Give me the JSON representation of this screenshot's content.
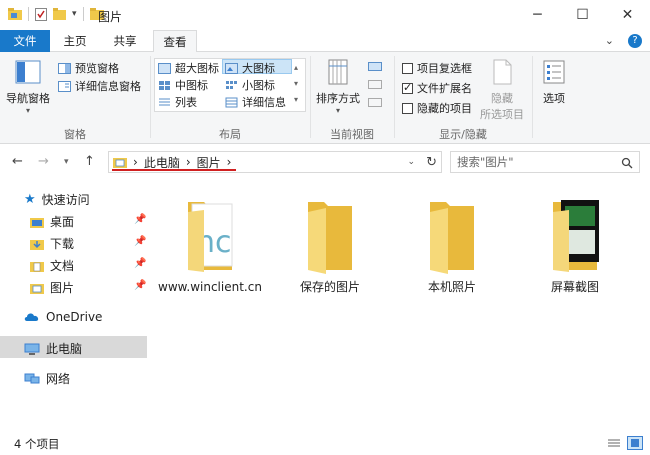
{
  "window": {
    "title": "图片",
    "controls": {
      "minimize": "─",
      "maximize": "☐",
      "close": "✕"
    }
  },
  "tabs": {
    "file": "文件",
    "home": "主页",
    "share": "共享",
    "view": "查看"
  },
  "ribbon": {
    "panes": {
      "label": "窗格",
      "nav_pane": "导航窗格",
      "preview_pane": "预览窗格",
      "details_pane": "详细信息窗格"
    },
    "layout": {
      "label": "布局",
      "extra_large": "超大图标",
      "large": "大图标",
      "medium": "中图标",
      "small": "小图标",
      "list": "列表",
      "details": "详细信息"
    },
    "current_view": {
      "label": "当前视图",
      "sort_by": "排序方式"
    },
    "show_hide": {
      "label": "显示/隐藏",
      "item_checkboxes": "项目复选框",
      "file_extensions": "文件扩展名",
      "hidden_items": "隐藏的项目",
      "hide_selected_line1": "隐藏",
      "hide_selected_line2": "所选项目"
    },
    "options": "选项"
  },
  "address": {
    "crumbs": [
      "此电脑",
      "图片"
    ],
    "search_placeholder": "搜索\"图片\""
  },
  "navpane": {
    "quick_access": "快速访问",
    "desktop": "桌面",
    "downloads": "下载",
    "documents": "文档",
    "pictures": "图片",
    "onedrive": "OneDrive",
    "this_pc": "此电脑",
    "network": "网络"
  },
  "items": [
    {
      "name": "www.winclient.cn"
    },
    {
      "name": "保存的图片"
    },
    {
      "name": "本机照片"
    },
    {
      "name": "屏幕截图"
    }
  ],
  "status": {
    "count": "4 个项目"
  },
  "colors": {
    "accent": "#1979ca",
    "folder": "#f0c94a",
    "selection": "#cce4f7"
  }
}
